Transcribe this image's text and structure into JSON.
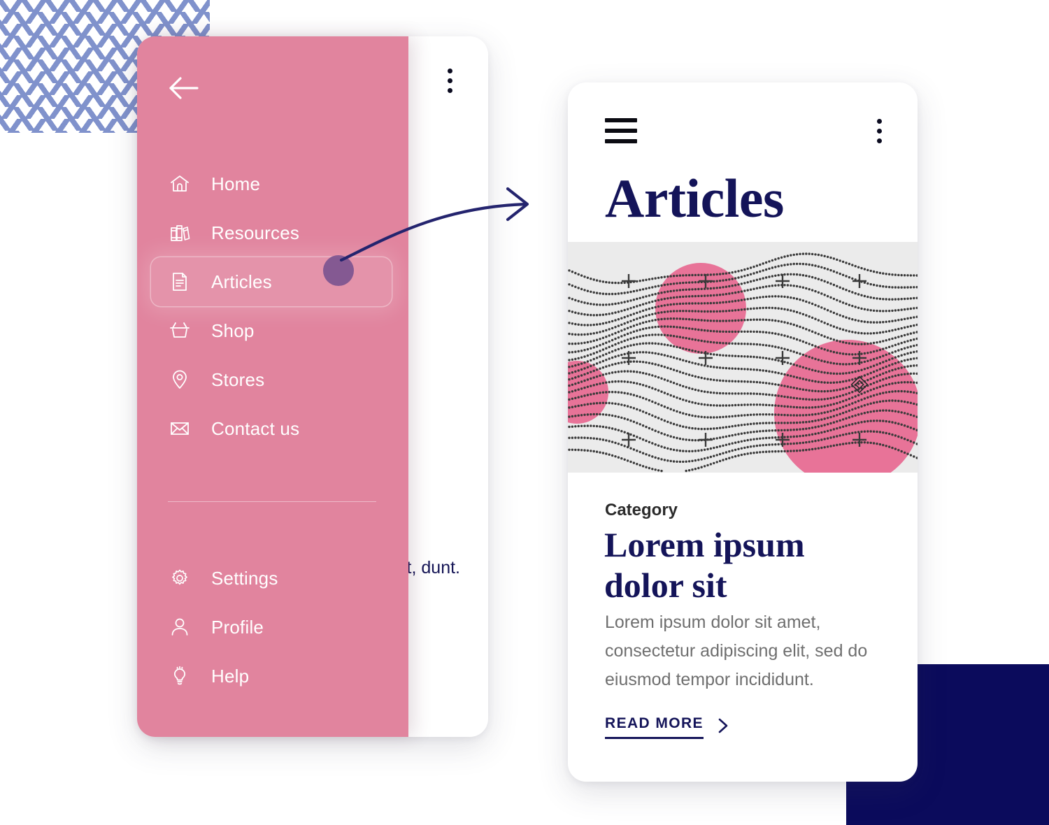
{
  "colors": {
    "sidebar_pink": "#E1849E",
    "navy": "#141459",
    "accent_purple": "#7C5490",
    "hero_bg": "#EBEBEB",
    "hero_circle_pink": "#E87398",
    "deco_blue": "#6B7FC4",
    "deco_navy_block": "#0B0B5C"
  },
  "sidebar": {
    "back_icon": "arrow-left-icon",
    "main_items": [
      {
        "label": "Home",
        "icon": "home-icon",
        "active": false
      },
      {
        "label": "Resources",
        "icon": "books-icon",
        "active": false
      },
      {
        "label": "Articles",
        "icon": "document-icon",
        "active": true
      },
      {
        "label": "Shop",
        "icon": "basket-icon",
        "active": false
      },
      {
        "label": "Stores",
        "icon": "location-pin-icon",
        "active": false
      },
      {
        "label": "Contact us",
        "icon": "envelope-icon",
        "active": false
      }
    ],
    "secondary_items": [
      {
        "label": "Settings",
        "icon": "gear-icon",
        "active": false
      },
      {
        "label": "Profile",
        "icon": "user-icon",
        "active": false
      },
      {
        "label": "Help",
        "icon": "lightbulb-icon",
        "active": false
      }
    ]
  },
  "back_phone": {
    "kebab_icon": "more-vertical-icon",
    "body_text": "met,\nelit,\ndunt."
  },
  "front_phone": {
    "menu_icon": "hamburger-menu-icon",
    "kebab_icon": "more-vertical-icon",
    "title": "Articles",
    "hero_alt": "abstract-dotted-wave-graphic",
    "article": {
      "category": "Category",
      "title": "Lorem ipsum dolor sit",
      "excerpt": "Lorem ipsum dolor sit amet, consectetur adipiscing elit, sed do eiusmod tempor incididunt.",
      "read_more_label": "READ MORE",
      "read_more_icon": "chevron-right-icon"
    }
  },
  "annotation": {
    "arrow_icon": "curved-arrow-right-icon"
  }
}
